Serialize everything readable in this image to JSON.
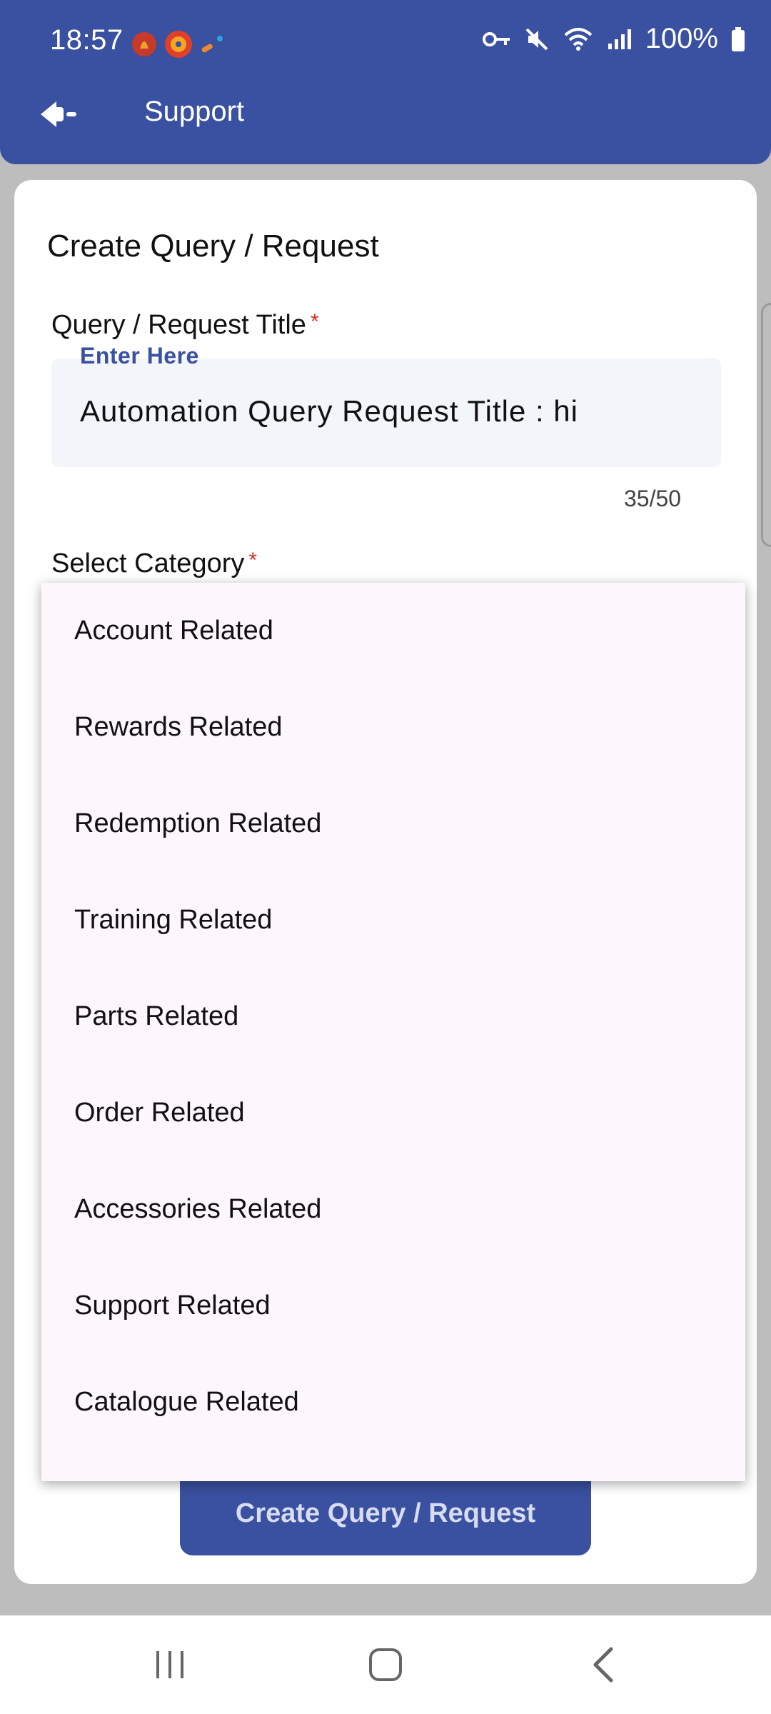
{
  "status_bar": {
    "time": "18:57",
    "battery": "100%",
    "icons": [
      "key-icon",
      "mute-icon",
      "wifi-icon",
      "signal-icon",
      "battery-icon"
    ]
  },
  "header": {
    "title": "Support",
    "color": "#3a50a0"
  },
  "form": {
    "title": "Create Query / Request",
    "title_field": {
      "label": "Query / Request Title",
      "required_mark": "*",
      "floating_label": "Enter Here",
      "value": "Automation Query Request Title : hi",
      "counter": "35/50"
    },
    "category_field": {
      "label": "Select Category",
      "required_mark": "*"
    },
    "submit_label": "Create Query / Request"
  },
  "dropdown": {
    "options": [
      "Account Related",
      "Rewards Related",
      "Redemption Related",
      "Training Related",
      "Parts Related",
      "Order Related",
      "Accessories Related",
      "Support Related",
      "Catalogue Related"
    ]
  },
  "nav": {
    "icons": [
      "recent-apps-icon",
      "home-icon",
      "back-icon"
    ]
  }
}
